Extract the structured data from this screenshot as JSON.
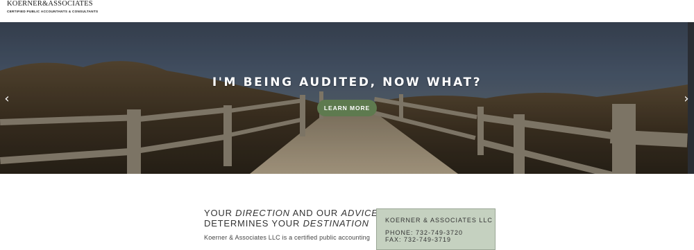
{
  "header": {
    "logo_name": "KOERNER&ASSOCIATES",
    "logo_sub": "CERTIFIED PUBLIC ACCOUNTANTS & CONSULTANTS"
  },
  "hero": {
    "title": "I'M BEING AUDITED, NOW WHAT?",
    "button_label": "LEARN MORE",
    "prev_icon": "chevron-left-icon",
    "next_icon": "chevron-right-icon"
  },
  "content": {
    "tagline_1a": "YOUR ",
    "tagline_1b": "DIRECTION",
    "tagline_1c": " AND OUR ",
    "tagline_1d": "ADVICE",
    "tagline_2a": "DETERMINES YOUR ",
    "tagline_2b": "DESTINATION",
    "body_start": "Koerner & Associates LLC is a certified public accounting"
  },
  "contact": {
    "firm": "KOERNER & ASSOCIATES LLC",
    "phone": "PHONE: 732-749-3720",
    "fax": "FAX: 732-749-3719"
  },
  "colors": {
    "button": "#5e7a4f",
    "contact_bg": "#c5d1c0"
  }
}
